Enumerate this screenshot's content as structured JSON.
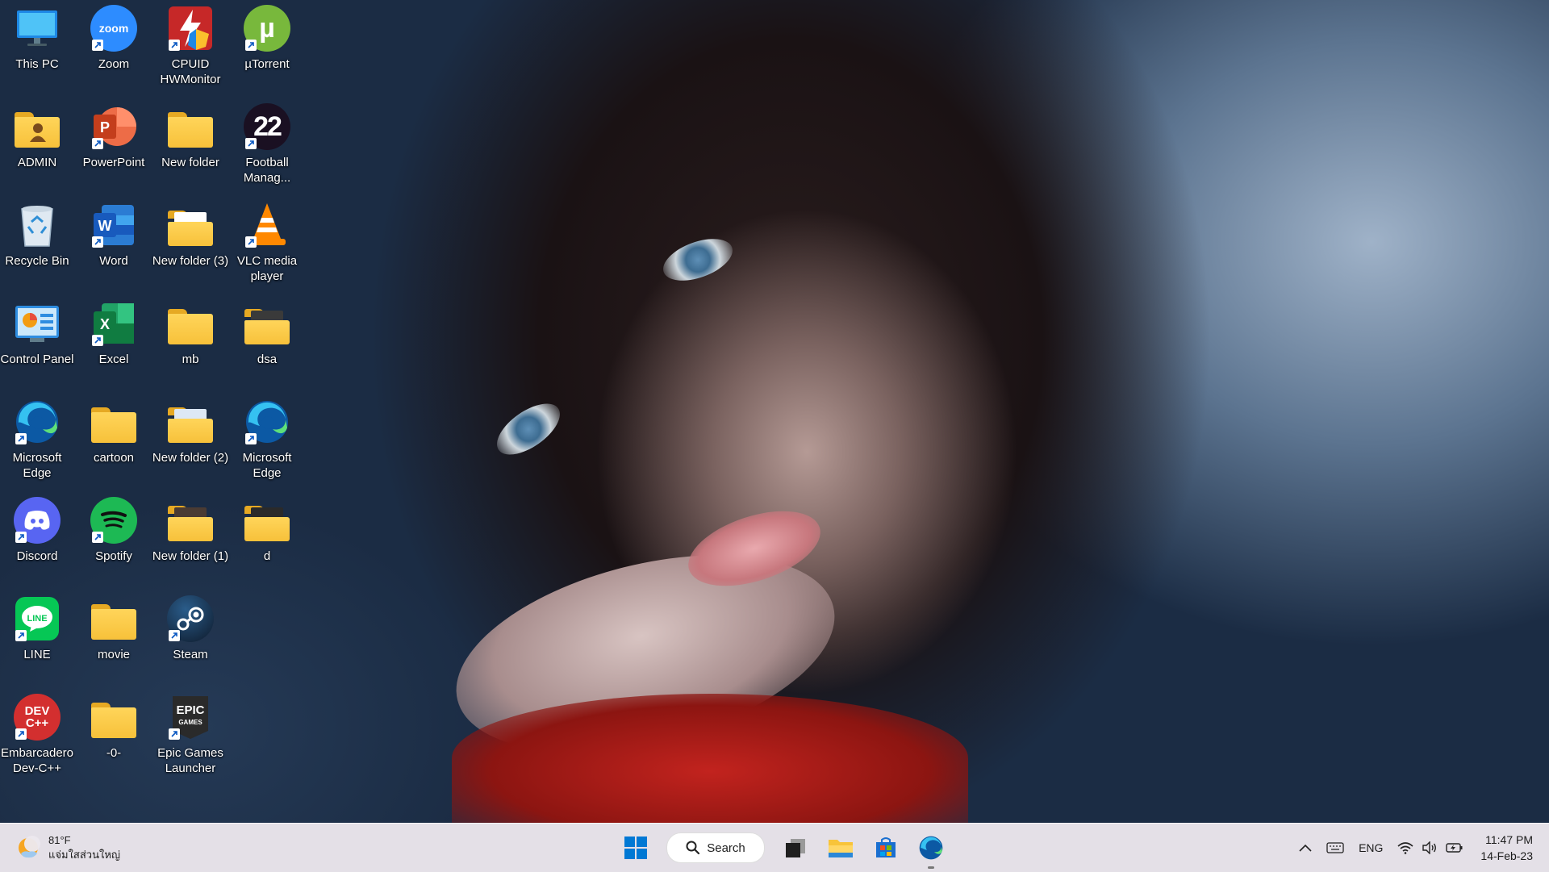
{
  "desktop": {
    "icons": [
      {
        "label": "This PC",
        "icon": "monitor-icon"
      },
      {
        "label": "Zoom",
        "icon": "zoom-icon"
      },
      {
        "label": "CPUID HWMonitor",
        "icon": "hwmonitor-icon"
      },
      {
        "label": "µTorrent",
        "icon": "utorrent-icon"
      },
      {
        "label": "ADMIN",
        "icon": "user-folder-icon"
      },
      {
        "label": "PowerPoint",
        "icon": "powerpoint-icon"
      },
      {
        "label": "New folder",
        "icon": "folder-icon"
      },
      {
        "label": "Football Manag...",
        "icon": "football-manager-icon"
      },
      {
        "label": "Recycle Bin",
        "icon": "recycle-bin-icon"
      },
      {
        "label": "Word",
        "icon": "word-icon"
      },
      {
        "label": "New folder (3)",
        "icon": "folder-icon"
      },
      {
        "label": "VLC media player",
        "icon": "vlc-icon"
      },
      {
        "label": "Control Panel",
        "icon": "control-panel-icon"
      },
      {
        "label": "Excel",
        "icon": "excel-icon"
      },
      {
        "label": "mb",
        "icon": "folder-icon"
      },
      {
        "label": "dsa",
        "icon": "folder-icon"
      },
      {
        "label": "Microsoft Edge",
        "icon": "edge-icon"
      },
      {
        "label": "cartoon",
        "icon": "folder-icon"
      },
      {
        "label": "New folder (2)",
        "icon": "folder-icon"
      },
      {
        "label": "Microsoft Edge",
        "icon": "edge-icon"
      },
      {
        "label": "Discord",
        "icon": "discord-icon"
      },
      {
        "label": "Spotify",
        "icon": "spotify-icon"
      },
      {
        "label": "New folder (1)",
        "icon": "folder-icon"
      },
      {
        "label": "d",
        "icon": "folder-icon"
      },
      {
        "label": "LINE",
        "icon": "line-icon"
      },
      {
        "label": "movie",
        "icon": "folder-icon"
      },
      {
        "label": "Steam",
        "icon": "steam-icon"
      },
      {
        "label": "Embarcadero Dev-C++",
        "icon": "devcpp-icon"
      },
      {
        "label": "-0-",
        "icon": "folder-icon"
      },
      {
        "label": "Epic Games Launcher",
        "icon": "epic-games-icon"
      }
    ]
  },
  "taskbar": {
    "weather": {
      "temp": "81°F",
      "desc": "แจ่มใสส่วนใหญ่"
    },
    "search_label": "Search",
    "pinned": [
      "start-icon",
      "task-view-icon",
      "file-explorer-icon",
      "store-icon",
      "edge-icon"
    ],
    "tray": {
      "language": "ENG"
    },
    "clock": {
      "time": "11:47 PM",
      "date": "14-Feb-23"
    }
  },
  "colors": {
    "folder": "#f7c13a",
    "taskbar": "#ece8ee",
    "accent": "#0067c0"
  }
}
